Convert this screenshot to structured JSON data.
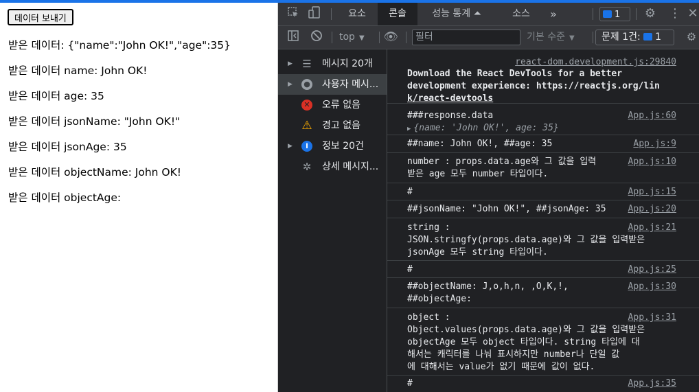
{
  "page": {
    "send_button": "데이터 보내기",
    "lines": [
      "받은 데이터: {\"name\":\"John OK!\",\"age\":35}",
      "받은 데이터 name: John OK!",
      "받은 데이터 age: 35",
      "받은 데이터 jsonName: \"John OK!\"",
      "받은 데이터 jsonAge: 35",
      "받은 데이터 objectName: John OK!",
      "받은 데이터 objectAge:"
    ]
  },
  "devtools": {
    "tabs": [
      "요소",
      "콘솔",
      "성능 통계 ⏶",
      "소스",
      "»"
    ],
    "active_tab": "콘솔",
    "issues_count": "1",
    "context": "top",
    "filter_placeholder": "필터",
    "levels_label": "기본 수준",
    "issues_label": "문제 1건:",
    "issues_label_count": "1",
    "sidebar": [
      {
        "label": "메시지 20개",
        "icon": "list-icon",
        "expandable": true,
        "selected": false
      },
      {
        "label": "사용자 메시...",
        "icon": "user-icon",
        "expandable": true,
        "selected": true
      },
      {
        "label": "오류 없음",
        "icon": "error-icon",
        "expandable": false,
        "selected": false
      },
      {
        "label": "경고 없음",
        "icon": "warning-icon",
        "expandable": false,
        "selected": false
      },
      {
        "label": "정보 20건",
        "icon": "info-icon",
        "expandable": true,
        "selected": false
      },
      {
        "label": "상세 메시지...",
        "icon": "bug-icon",
        "expandable": false,
        "selected": false
      }
    ],
    "messages": [
      {
        "source": "react-dom.development.js:29840",
        "lines": [
          "Download the React DevTools for a better",
          "development experience: https://reactjs.org/lin",
          "k/react-devtools"
        ]
      },
      {
        "source": "App.js:60",
        "lines": [
          "###response.data",
          "{name: 'John OK!', age: 35}"
        ]
      },
      {
        "source": "App.js:9",
        "lines": [
          "##name: John OK!, ##age: 35"
        ]
      },
      {
        "source": "App.js:10",
        "lines": [
          "number : props.data.age와 그 값을 입력",
          "받은 age 모두 number 타입이다."
        ]
      },
      {
        "source": "App.js:15",
        "lines": [
          "#"
        ]
      },
      {
        "source": "App.js:20",
        "lines": [
          "##jsonName: \"John OK!\", ##jsonAge: 35"
        ]
      },
      {
        "source": "App.js:21",
        "lines": [
          "string :",
          "JSON.stringfy(props.data.age)와 그 값을 입력받은",
          "jsonAge 모두 string 타입이다."
        ]
      },
      {
        "source": "App.js:25",
        "lines": [
          "#"
        ]
      },
      {
        "source": "App.js:30",
        "lines": [
          "##objectName: J,o,h,n, ,O,K,!,",
          "##objectAge:"
        ]
      },
      {
        "source": "App.js:31",
        "lines": [
          "object :",
          "Object.values(props.data.age)와 그 값을 입력받은",
          "objectAge 모두 object 타입이다. string 타입에 대",
          "해서는 캐릭터를 나눠 표시하지만 number나 단일 값",
          "에 대해서는 value가 없기 때문에 값이 없다."
        ]
      },
      {
        "source": "App.js:35",
        "lines": [
          "#"
        ]
      }
    ]
  },
  "colors": {
    "accent": "#1a73e8",
    "devtools_bg": "#202124",
    "toolbar_bg": "#35363a",
    "error": "#d93025",
    "warning": "#f9ab00",
    "info": "#1a73e8"
  }
}
